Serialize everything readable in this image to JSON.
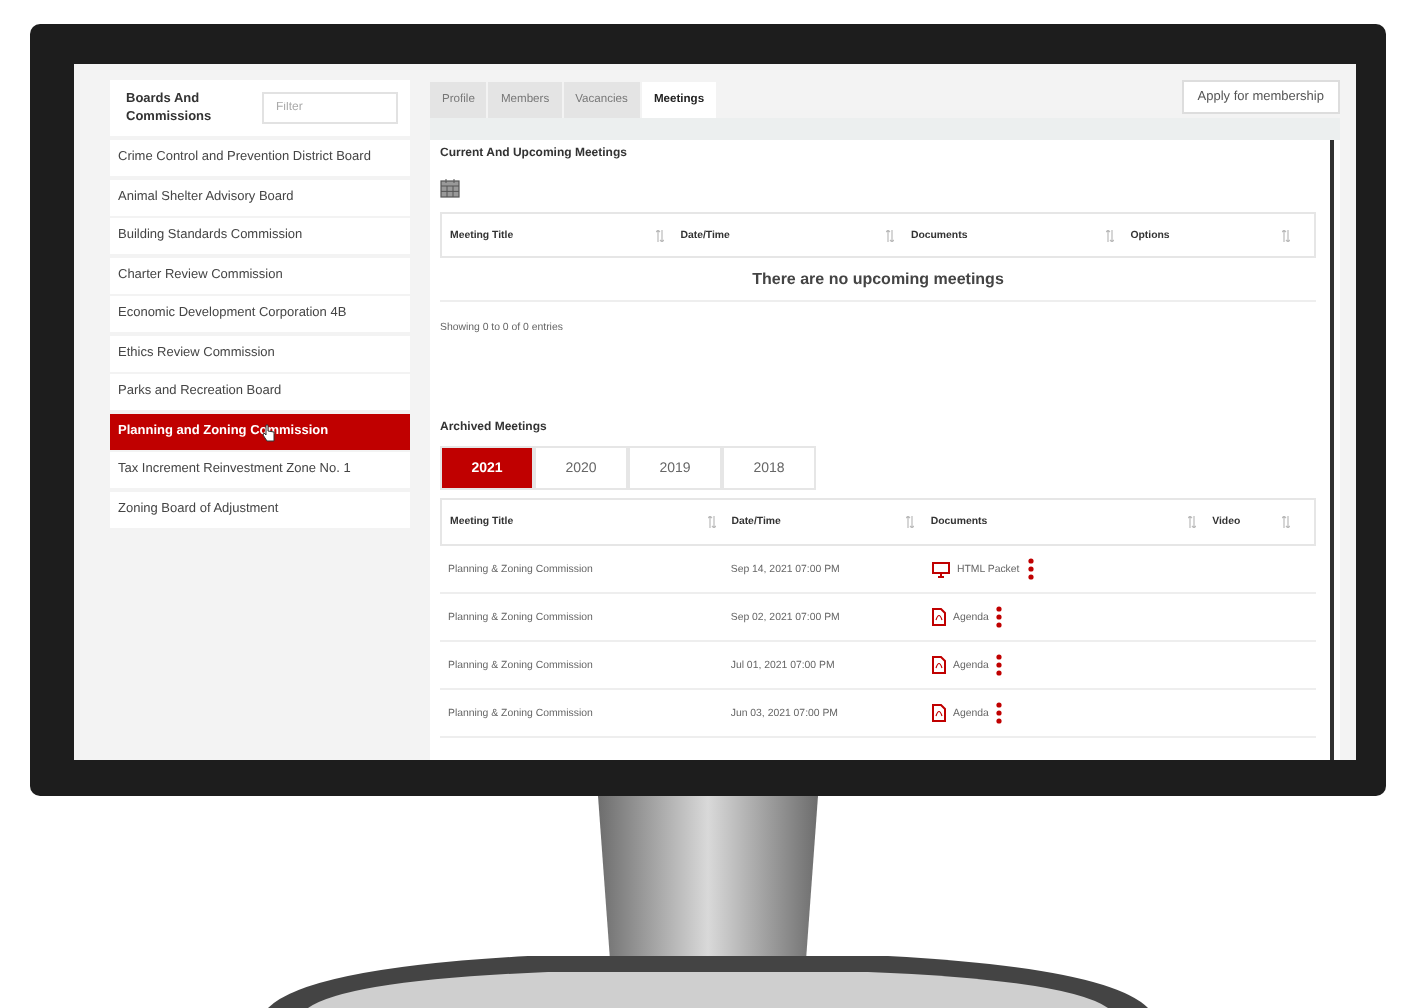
{
  "sidebar": {
    "title": "Boards And Commissions",
    "filter_placeholder": "Filter",
    "items": [
      {
        "label": "Crime Control and Prevention District Board",
        "selected": false
      },
      {
        "label": "Animal Shelter Advisory Board",
        "selected": false
      },
      {
        "label": "Building Standards Commission",
        "selected": false
      },
      {
        "label": "Charter Review Commission",
        "selected": false
      },
      {
        "label": "Economic Development Corporation 4B",
        "selected": false
      },
      {
        "label": "Ethics Review Commission",
        "selected": false
      },
      {
        "label": "Parks and Recreation Board",
        "selected": false
      },
      {
        "label": "Planning and Zoning Commission",
        "selected": true
      },
      {
        "label": "Tax Increment Reinvestment Zone No. 1",
        "selected": false
      },
      {
        "label": "Zoning Board of Adjustment",
        "selected": false
      }
    ]
  },
  "tabs": [
    {
      "label": "Profile",
      "selected": false
    },
    {
      "label": "Members",
      "selected": false
    },
    {
      "label": "Vacancies",
      "selected": false
    },
    {
      "label": "Meetings",
      "selected": true
    }
  ],
  "apply_button": "Apply for membership",
  "upcoming": {
    "title": "Current And Upcoming Meetings",
    "columns": [
      "Meeting Title",
      "Date/Time",
      "Documents",
      "Options"
    ],
    "empty_message": "There are no upcoming meetings",
    "info": "Showing 0 to 0 of 0 entries"
  },
  "archived": {
    "title": "Archived Meetings",
    "years": [
      {
        "label": "2021",
        "selected": true
      },
      {
        "label": "2020",
        "selected": false
      },
      {
        "label": "2019",
        "selected": false
      },
      {
        "label": "2018",
        "selected": false
      }
    ],
    "columns": [
      "Meeting Title",
      "Date/Time",
      "Documents",
      "Video"
    ],
    "rows": [
      {
        "title": "Planning & Zoning Commission",
        "datetime": "Sep 14, 2021 07:00 PM",
        "document": {
          "kind": "presentation",
          "label": "HTML Packet"
        }
      },
      {
        "title": "Planning & Zoning Commission",
        "datetime": "Sep 02, 2021 07:00 PM",
        "document": {
          "kind": "pdf",
          "label": "Agenda"
        }
      },
      {
        "title": "Planning & Zoning Commission",
        "datetime": "Jul 01, 2021 07:00 PM",
        "document": {
          "kind": "pdf",
          "label": "Agenda"
        }
      },
      {
        "title": "Planning & Zoning Commission",
        "datetime": "Jun 03, 2021 07:00 PM",
        "document": {
          "kind": "pdf",
          "label": "Agenda"
        }
      }
    ]
  }
}
